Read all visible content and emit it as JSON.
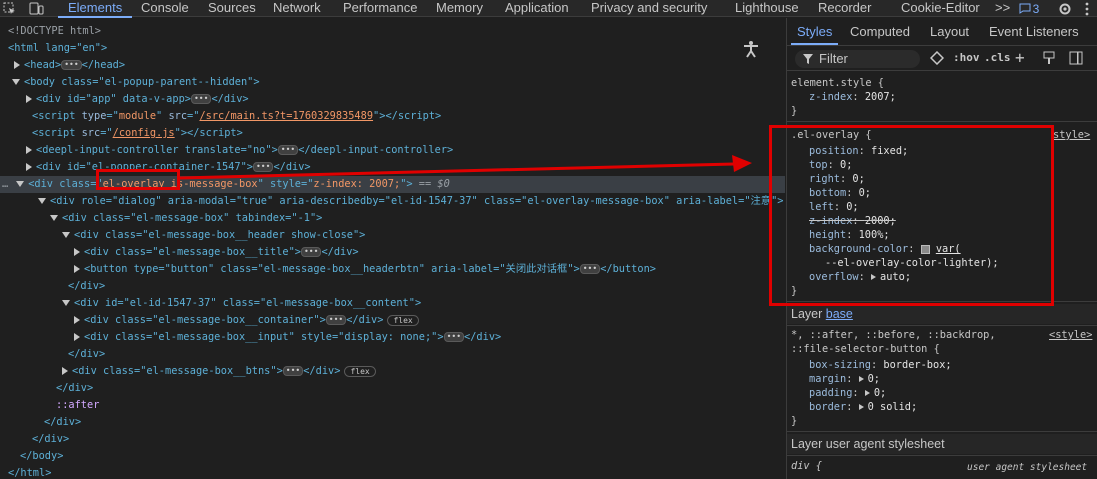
{
  "devtools": {
    "tabs": [
      "Elements",
      "Console",
      "Sources",
      "Network",
      "Performance",
      "Memory",
      "Application",
      "Privacy and security",
      "Lighthouse",
      "Recorder",
      "Cookie-Editor"
    ],
    "more_tabs": ">>",
    "message_count": "3"
  },
  "dom": {
    "lines": [
      {
        "text": "<!DOCTYPE html>"
      },
      {
        "html": "<html lang=\"en\">"
      },
      {
        "head": "<head>",
        "tail": "</head>"
      },
      {
        "body": "<body class=\"el-popup-parent--hidden\">"
      },
      {
        "app": "<div id=\"app\" data-v-app>",
        "tail": "</div>"
      },
      {
        "script_type": "module",
        "script_src": "/src/main.ts?t=1760329835489"
      },
      {
        "script_src": "/config.js"
      },
      {
        "deepl_open": "<deepl-input-controller translate=\"no\">",
        "deepl_close": "</deepl-input-controller>"
      },
      {
        "popper": "<div id=\"el-popper-container-1547\">",
        "tail": "</div>"
      },
      {
        "overlay_pre": "<div class=\"",
        "overlay_class": "el-overlay is-message-box",
        "overlay_mid": "\" style=\"",
        "overlay_style": "z-index: 2007;",
        "overlay_end": "\">",
        "sel_marker": "== $0"
      },
      {
        "dialog": "<div role=\"dialog\" aria-modal=\"true\" aria-describedby=\"el-id-1547-37\" class=\"el-overlay-message-box\" aria-label=\"注意\">"
      },
      {
        "mbox": "<div class=\"el-message-box\" tabindex=\"-1\">"
      },
      {
        "header": "<div class=\"el-message-box__header show-close\">"
      },
      {
        "title": "<div class=\"el-message-box__title\">",
        "tail": "</div>"
      },
      {
        "btn": "<button type=\"button\" class=\"el-message-box__headerbtn\" aria-label=\"关闭此对话框\">",
        "tail": "</button>"
      },
      {
        "close": "</div>"
      },
      {
        "content": "<div id=\"el-id-1547-37\" class=\"el-message-box__content\">"
      },
      {
        "container": "<div class=\"el-message-box__container\">",
        "tail": "</div>",
        "badge": "flex"
      },
      {
        "input": "<div class=\"el-message-box__input\" style=\"display: none;\">",
        "tail": "</div>"
      },
      {
        "close": "</div>"
      },
      {
        "btns": "<div class=\"el-message-box__btns\">",
        "tail": "</div>",
        "badge": "flex"
      },
      {
        "close": "</div>"
      },
      {
        "after": "::after"
      },
      {
        "close": "</div>"
      },
      {
        "close": "</div>"
      },
      {
        "close": "</body>"
      },
      {
        "close": "</html>"
      }
    ]
  },
  "styles": {
    "tabs": [
      "Styles",
      "Computed",
      "Layout",
      "Event Listeners"
    ],
    "filter_placeholder": "Filter",
    "hov": ":hov",
    "cls": ".cls",
    "element_style": {
      "selector": "element.style {",
      "prop": "z-index",
      "value": "2007;"
    },
    "overlay_rule": {
      "selector": ".el-overlay {",
      "source": "style>",
      "props": [
        {
          "n": "position",
          "v": "fixed;"
        },
        {
          "n": "top",
          "v": "0;"
        },
        {
          "n": "right",
          "v": "0;"
        },
        {
          "n": "bottom",
          "v": "0;"
        },
        {
          "n": "left",
          "v": "0;"
        },
        {
          "n": "z-index",
          "v": "2000;",
          "struck": true
        },
        {
          "n": "height",
          "v": "100%;"
        },
        {
          "n": "background-color",
          "v": "var("
        },
        {
          "n": "",
          "v": "--el-overlay-color-lighter);"
        },
        {
          "n": "overflow",
          "v": "auto;"
        }
      ]
    },
    "layer_base": {
      "label": "Layer ",
      "link": "base"
    },
    "universal_rule": {
      "selector1": "*, ::after, ::before, ::backdrop,",
      "selector2": "::file-selector-button {",
      "source": "<style>",
      "props": [
        {
          "n": "box-sizing",
          "v": "border-box;"
        },
        {
          "n": "margin",
          "v": "0;"
        },
        {
          "n": "padding",
          "v": "0;"
        },
        {
          "n": "border",
          "v": "0 solid;"
        }
      ]
    },
    "layer_ua": "Layer user agent stylesheet",
    "ua_rule": {
      "selector": "div {",
      "source": "user agent stylesheet"
    }
  },
  "colors": {
    "accent": "#7cacf8",
    "annotation_red": "#e00000"
  }
}
